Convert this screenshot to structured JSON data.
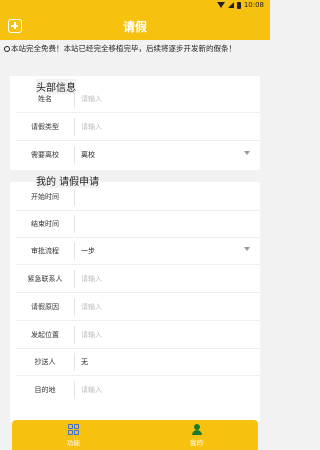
{
  "status_bar": {
    "time": "10:08"
  },
  "header": {
    "title": "请假"
  },
  "notice": "本站完全免费！本站已经完全移植完毕，后续将逐步开发新的假条！",
  "section_header": {
    "title": "头部信息"
  },
  "section_apply": {
    "title": "我的 请假申请"
  },
  "form_a": [
    {
      "label": "姓名",
      "placeholder": "请输入"
    },
    {
      "label": "请假类型",
      "placeholder": "请输入"
    },
    {
      "label": "需要离校",
      "value": "离校"
    }
  ],
  "form_b": [
    {
      "label": "开始时间",
      "placeholder": ""
    },
    {
      "label": "结束时间",
      "placeholder": ""
    },
    {
      "label": "审批流程",
      "value": "一步"
    },
    {
      "label": "紧急联系人",
      "placeholder": "请输入"
    },
    {
      "label": "请假原因",
      "placeholder": "请输入"
    },
    {
      "label": "发起位置",
      "placeholder": "请输入"
    },
    {
      "label": "抄送人",
      "value": "无"
    },
    {
      "label": "目的地",
      "placeholder": "请输入"
    }
  ],
  "tabbar": {
    "functions": "功能",
    "mine": "我的"
  },
  "colors": {
    "accent": "#f7c20f",
    "background": "#f2f2f2"
  },
  "icons": [
    "add-icon",
    "info-icon",
    "chevron-down-icon",
    "grid-icon",
    "person-icon"
  ]
}
